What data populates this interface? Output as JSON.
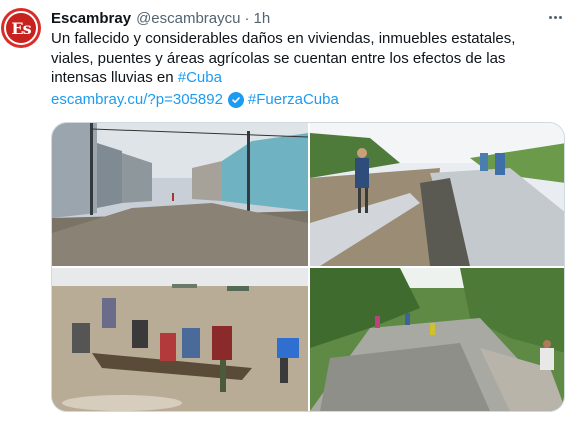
{
  "tweet": {
    "avatar_text": "Es",
    "display_name": "Escambray",
    "handle": "@escambraycu",
    "separator": "·",
    "time": "1h",
    "text": "Un fallecido y considerables daños en viviendas, inmuebles estatales, viales, puentes y áreas agrícolas se cuentan entre los efectos de las intensas lluvias en ",
    "hashtag_1": "#Cuba",
    "url": "escambray.cu/?p=305892",
    "hashtag_2": "#FuerzaCuba"
  },
  "icons": {
    "more": "more-horizontal-icon",
    "check": "check-circle-emoji-icon"
  },
  "colors": {
    "link": "#1d9bf0",
    "check_badge": "#1d9bf0",
    "brand": "#d92d2a"
  }
}
